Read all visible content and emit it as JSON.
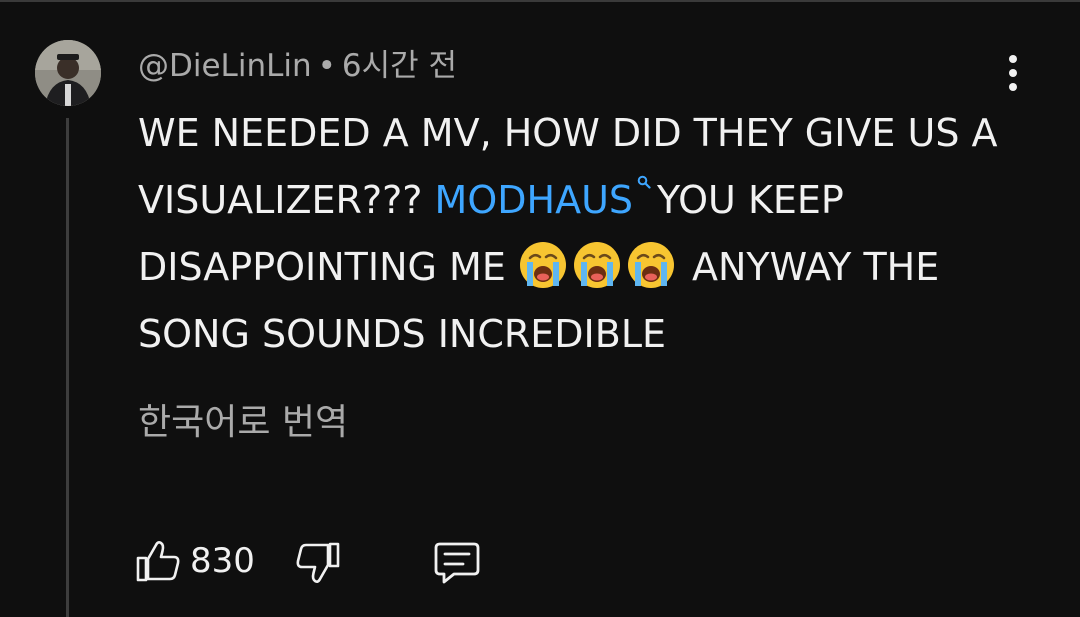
{
  "comment": {
    "author": "@DieLinLin",
    "separator": "•",
    "timestamp": "6시간 전",
    "text_before_mention": "WE NEEDED A MV, HOW DID THEY GIVE US A VISUALIZER??? ",
    "mention": "MODHAUS",
    "text_after_mention": "YOU KEEP DISAPPOINTING ME ",
    "emoji": [
      "loudly-crying-face",
      "loudly-crying-face",
      "loudly-crying-face"
    ],
    "text_end": " ANYWAY THE SONG SOUNDS INCREDIBLE",
    "translate_label": "한국어로 번역",
    "like_count": "830"
  },
  "icons": {
    "more": "vertical-dots-icon",
    "mention": "search-icon",
    "like": "thumbs-up-icon",
    "dislike": "thumbs-down-icon",
    "reply": "comment-icon"
  },
  "colors": {
    "background": "#0f0f0f",
    "text": "#f1f1f1",
    "secondary_text": "#aaaaaa",
    "mention": "#3ea6ff",
    "thread_line": "#3d3d3d"
  }
}
